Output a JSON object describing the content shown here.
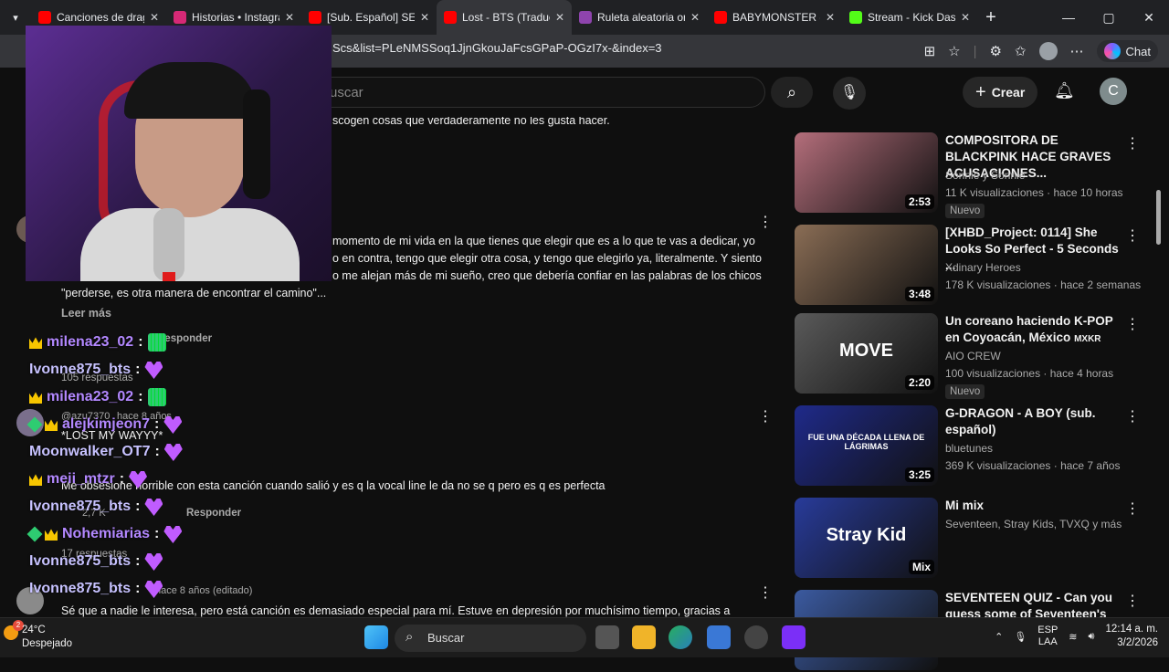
{
  "browser": {
    "tabs": [
      {
        "title": "Canciones de drago",
        "color": "#ff0000"
      },
      {
        "title": "Historias • Instagra",
        "color": "#d62976"
      },
      {
        "title": "[Sub. Español] SEVE",
        "color": "#ff0000"
      },
      {
        "title": "Lost - BTS (Traducc",
        "color": "#ff0000",
        "active": true
      },
      {
        "title": "Ruleta aleatoria on",
        "color": "#8e44ad"
      },
      {
        "title": "BABYMONSTER - 'F",
        "color": "#ff0000"
      },
      {
        "title": "Stream - Kick Dash",
        "color": "#53fc18"
      }
    ],
    "url": "Scs&list=PLeNMSSoq1JjnGkouJaFcsGPaP-OGzI7x-&index=3",
    "chat_label": "Chat"
  },
  "youtube": {
    "search_placeholder": "uscar",
    "create_label": "Crear",
    "avatar_letter": "C"
  },
  "comments": {
    "line1": "scogen cosas que verdaderamente no les gusta hacer.",
    "block2_line1": "momento de mi vida en la que tienes que elegir que es a lo que te vas a dedicar, yo",
    "block2_line2": "o en contra, tengo que elegir otra cosa, y tengo que elegirlo ya, literalmente. Y siento",
    "block2_line3": "o me alejan más de mi sueño, creo que debería confiar en las palabras de los chicos",
    "block2_line4": "\"perderse, es otra manera de encontrar el camino\"...",
    "read_more": "Leer más",
    "reply1": "Responder",
    "replies1": "105 respuestas",
    "author3": "@azu7370",
    "time3": "hace 8 años",
    "text3a": "*LOST MY WAYYY*",
    "text3b": "Me obsesione horrible con esta canción cuando salió y es q la vocal line le da no se q pero es q es perfecta",
    "likes3": "2,7 K",
    "reply3": "Responder",
    "replies3": "17 respuestas",
    "time4": "hace 8 años (editado)",
    "text4": "Sé que a nadie le interesa, pero está canción es demasiado especial para mí. Estuve en depresión por muchísimo tiempo, gracias a"
  },
  "live_chat": [
    {
      "user": "milena23_02",
      "color": "#b388ff",
      "badge": "crown",
      "emote": "green"
    },
    {
      "user": "Ivonne875_bts",
      "color": "#c7c2ff",
      "badge": "",
      "emote": "heart"
    },
    {
      "user": "milena23_02",
      "color": "#b388ff",
      "badge": "crown",
      "emote": "green"
    },
    {
      "user": "alejkimjeon7",
      "color": "#b388ff",
      "badge": "gem-crown",
      "emote": "heart"
    },
    {
      "user": "Moonwalker_OT7",
      "color": "#c7c2ff",
      "badge": "",
      "emote": "heart"
    },
    {
      "user": "meii_mtzr",
      "color": "#b388ff",
      "badge": "crown",
      "emote": "heart"
    },
    {
      "user": "Ivonne875_bts",
      "color": "#c7c2ff",
      "badge": "",
      "emote": "heart"
    },
    {
      "user": "Nohemiarias",
      "color": "#b388ff",
      "badge": "gem-crown",
      "emote": "heart"
    },
    {
      "user": "Ivonne875_bts",
      "color": "#c7c2ff",
      "badge": "",
      "emote": "heart"
    },
    {
      "user": "Ivonne875_bts",
      "color": "#c7c2ff",
      "badge": "",
      "emote": "heart"
    }
  ],
  "sidebar": [
    {
      "title": "COMPOSITORA DE BLACKPINK HACE GRAVES ACUSACIONES...",
      "channel": "Sonnie y Sonnie",
      "meta": "11 K visualizaciones · hace 10 horas",
      "duration": "2:53",
      "new": "Nuevo",
      "thumb": "#b46e7b"
    },
    {
      "title": "[XHBD_Project: 0114] She Looks So Perfect - 5 Seconds ...",
      "channel": "Xdinary Heroes",
      "meta": "178 K visualizaciones · hace 2 semanas",
      "duration": "3:48",
      "new": "",
      "thumb": "#8a6d55"
    },
    {
      "title": "Un coreano haciendo K-POP en Coyoacán, México",
      "title_suffix": "MXKR",
      "channel": "AIO CREW",
      "meta": "100 visualizaciones · hace 4 horas",
      "duration": "2:20",
      "new": "Nuevo",
      "thumb": "#5a5a5a",
      "thumb_text": "MOVE"
    },
    {
      "title": "G-DRAGON - A BOY (sub. español)",
      "channel": "bluetunes",
      "meta": "369 K visualizaciones · hace 7 años",
      "duration": "3:25",
      "new": "",
      "thumb": "#1f2a8a",
      "thumb_text": "FUE UNA DÉCADA LLENA DE LÁGRIMAS"
    },
    {
      "title": "Mi mix",
      "channel": "Seventeen, Stray Kids, TVXQ y más",
      "meta": "",
      "duration": "Mix",
      "new": "",
      "thumb": "#283b9a",
      "thumb_text": "Stray Kid"
    },
    {
      "title": "SEVENTEEN QUIZ - Can you guess some of Seventeen's",
      "channel": "",
      "meta": "",
      "duration": "",
      "new": "",
      "thumb": "#3b5aa0"
    }
  ],
  "taskbar": {
    "temp": "24°C",
    "weather": "Despejado",
    "weather_badge": "2",
    "search": "Buscar",
    "lang1": "ESP",
    "lang2": "LAA",
    "time": "12:14 a. m.",
    "date": "3/2/2026"
  }
}
